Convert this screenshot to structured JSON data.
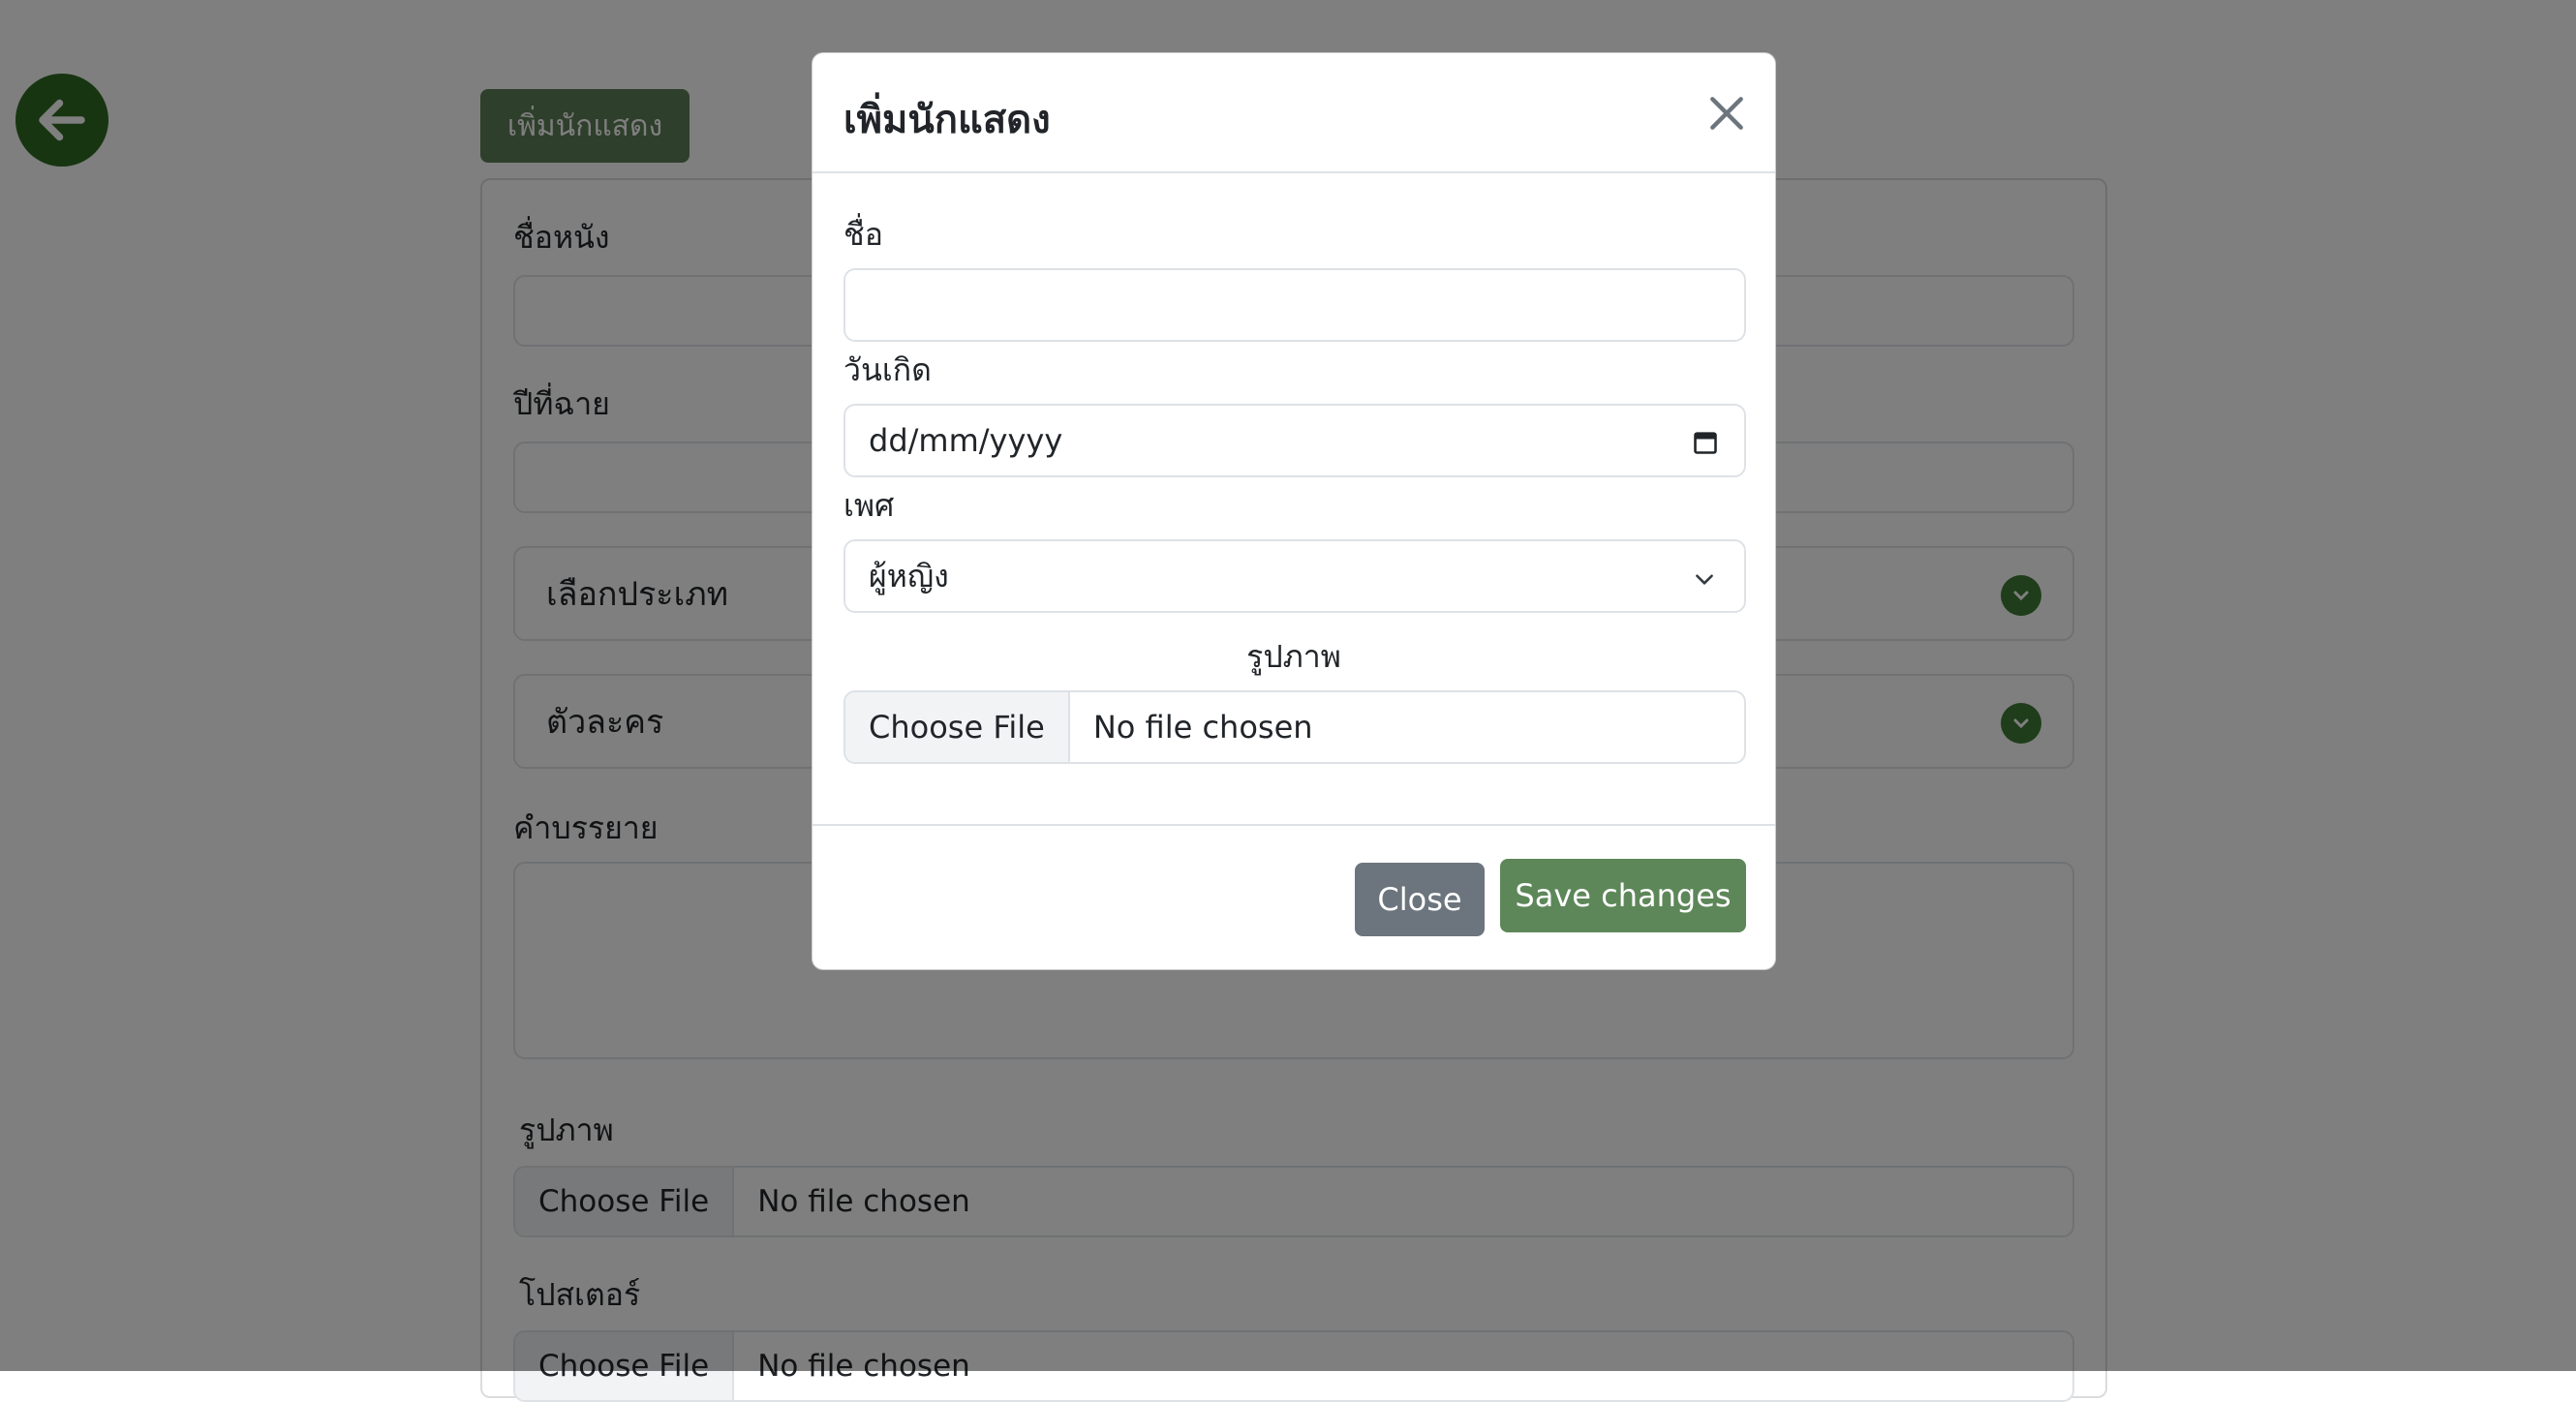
{
  "background": {
    "add_actor_button": "เพิ่มนักแสดง",
    "labels": {
      "movie_name": "ชื่อหนัง",
      "release_year": "ปีที่ฉาย",
      "description": "คำบรรยาย",
      "image": "รูปภาพ",
      "poster": "โปสเตอร์"
    },
    "selects": {
      "genre": "เลือกประเภท",
      "character": "ตัวละคร"
    },
    "file_inputs": {
      "button": "Choose File",
      "status": "No file chosen"
    }
  },
  "modal": {
    "title": "เพิ่มนักแสดง",
    "name_label": "ชื่อ",
    "name_value": "",
    "birthdate_label": "วันเกิด",
    "birthdate_placeholder": "dd/mm/yyyy",
    "gender_label": "เพศ",
    "gender_value": "ผู้หญิง",
    "image_label": "รูปภาพ",
    "file_button": "Choose File",
    "file_status": "No file chosen",
    "close_button": "Close",
    "save_button": "Save changes"
  },
  "colors": {
    "back_button": "#2f6b22",
    "save_button": "#5d8759",
    "close_button": "#6c757d"
  },
  "icons": [
    "arrow-left-icon",
    "chevron-down-icon",
    "close-icon",
    "calendar-icon"
  ]
}
